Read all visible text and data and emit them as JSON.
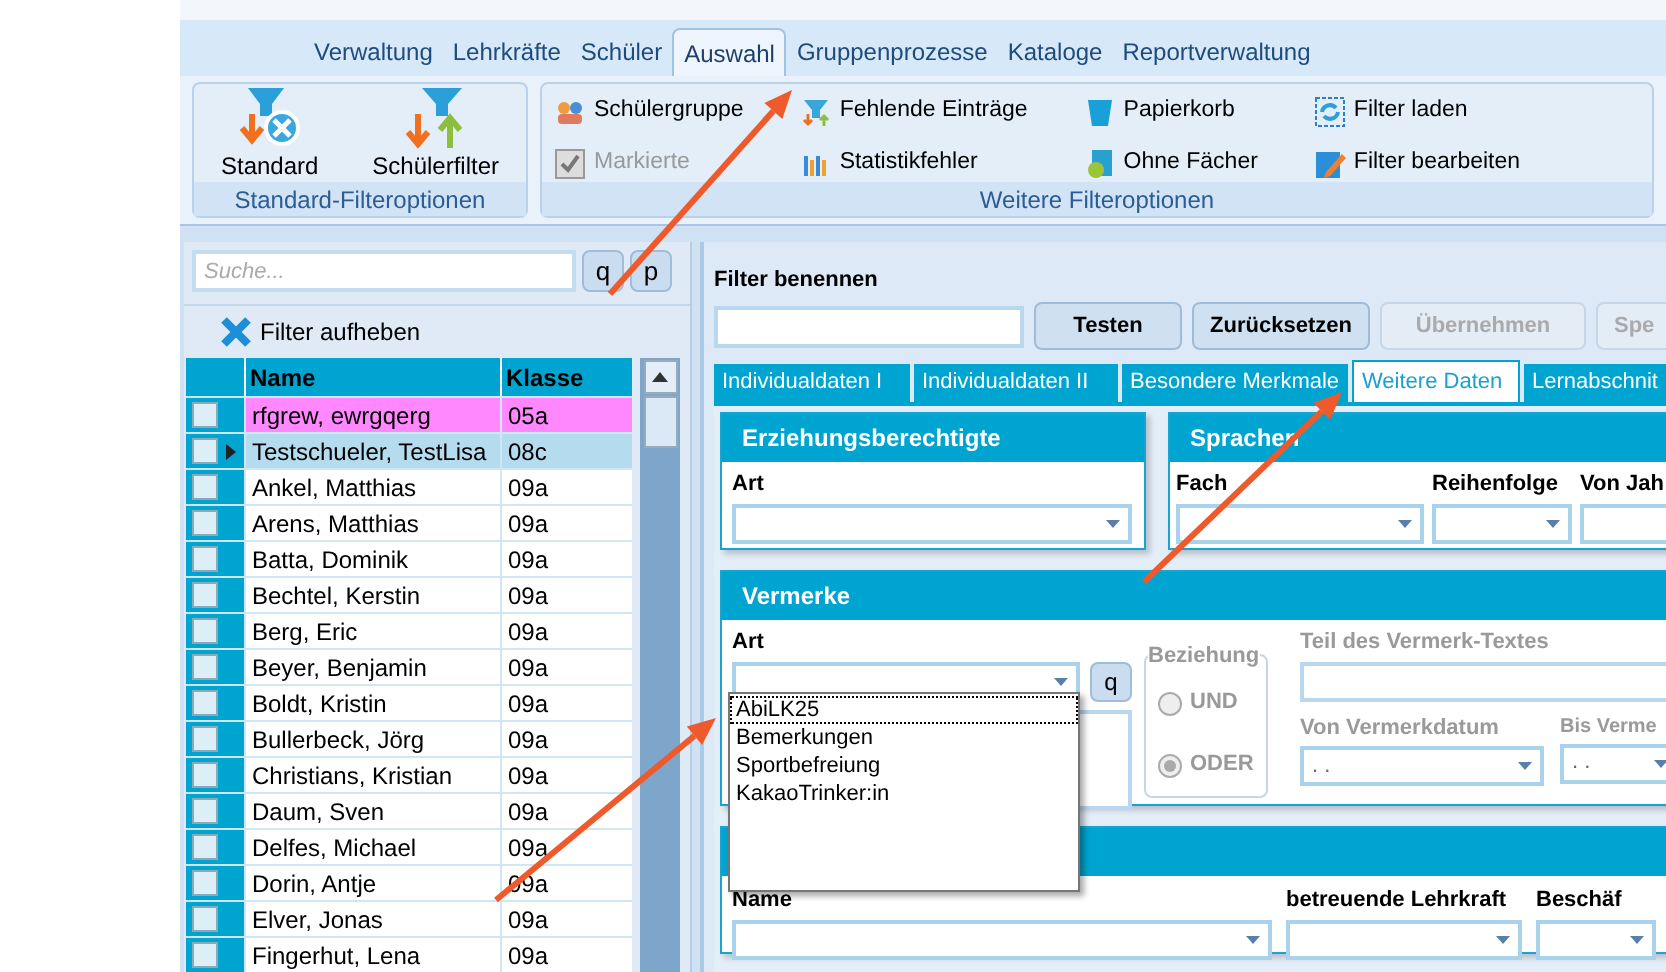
{
  "ribbon": {
    "tabs": [
      {
        "label": "Verwaltung",
        "selected": false
      },
      {
        "label": "Lehrkräfte",
        "selected": false
      },
      {
        "label": "Schüler",
        "selected": false
      },
      {
        "label": "Auswahl",
        "selected": true
      },
      {
        "label": "Gruppenprozesse",
        "selected": false
      },
      {
        "label": "Kataloge",
        "selected": false
      },
      {
        "label": "Reportverwaltung",
        "selected": false
      }
    ],
    "standard_group": {
      "caption": "Standard-Filteroptionen",
      "buttons": [
        {
          "label": "Standard",
          "kind": "standard"
        },
        {
          "label": "Schülerfilter",
          "kind": "filter"
        }
      ]
    },
    "more_group": {
      "caption": "Weitere Filteroptionen",
      "columns": [
        [
          {
            "label": "Schülergruppe",
            "kind": "group",
            "disabled": false
          },
          {
            "label": "Markierte",
            "kind": "check",
            "disabled": true
          }
        ],
        [
          {
            "label": "Fehlende Einträge",
            "kind": "missing",
            "disabled": false
          },
          {
            "label": "Statistikfehler",
            "kind": "stats",
            "disabled": false
          }
        ],
        [
          {
            "label": "Papierkorb",
            "kind": "bin",
            "disabled": false
          },
          {
            "label": "Ohne Fächer",
            "kind": "nosubject",
            "disabled": false
          }
        ],
        [
          {
            "label": "Filter laden",
            "kind": "load",
            "disabled": false
          },
          {
            "label": "Filter bearbeiten",
            "kind": "edit",
            "disabled": false
          }
        ]
      ]
    }
  },
  "student_list": {
    "search": {
      "placeholder": "Suche..."
    },
    "search_buttons": [
      "q",
      "p"
    ],
    "clear_filter": "Filter aufheben",
    "columns": [
      "Name",
      "Klasse"
    ],
    "rows": [
      {
        "name": "rfgrew, ewrgqerg",
        "class": "05a",
        "checked": false,
        "selected": false,
        "color": "#ff88ff"
      },
      {
        "name": "Testschueler, TestLisa",
        "class": "08c",
        "checked": false,
        "selected": true
      },
      {
        "name": "Ankel, Matthias",
        "class": "09a",
        "checked": false,
        "selected": false
      },
      {
        "name": "Arens, Matthias",
        "class": "09a",
        "checked": false,
        "selected": false
      },
      {
        "name": "Batta, Dominik",
        "class": "09a",
        "checked": false,
        "selected": false
      },
      {
        "name": "Bechtel, Kerstin",
        "class": "09a",
        "checked": false,
        "selected": false
      },
      {
        "name": "Berg, Eric",
        "class": "09a",
        "checked": false,
        "selected": false
      },
      {
        "name": "Beyer, Benjamin",
        "class": "09a",
        "checked": false,
        "selected": false
      },
      {
        "name": "Boldt, Kristin",
        "class": "09a",
        "checked": false,
        "selected": false
      },
      {
        "name": "Bullerbeck, Jörg",
        "class": "09a",
        "checked": false,
        "selected": false
      },
      {
        "name": "Christians, Kristian",
        "class": "09a",
        "checked": false,
        "selected": false
      },
      {
        "name": "Daum, Sven",
        "class": "09a",
        "checked": false,
        "selected": false
      },
      {
        "name": "Delfes, Michael",
        "class": "09a",
        "checked": false,
        "selected": false
      },
      {
        "name": "Dorin, Antje",
        "class": "09a",
        "checked": false,
        "selected": false
      },
      {
        "name": "Elver, Jonas",
        "class": "09a",
        "checked": false,
        "selected": false
      },
      {
        "name": "Fingerhut, Lena",
        "class": "09a",
        "checked": false,
        "selected": false
      }
    ]
  },
  "filter": {
    "name_label": "Filter benennen",
    "buttons": [
      {
        "label": "Testen",
        "disabled": false
      },
      {
        "label": "Zurücksetzen",
        "disabled": false
      },
      {
        "label": "Übernehmen",
        "disabled": true
      },
      {
        "label": "Spe",
        "disabled": true
      }
    ],
    "tabs": [
      {
        "label": "Individualdaten I",
        "selected": false
      },
      {
        "label": "Individualdaten II",
        "selected": false
      },
      {
        "label": "Besondere Merkmale",
        "selected": false
      },
      {
        "label": "Weitere Daten",
        "selected": true
      },
      {
        "label": "Lernabschnit",
        "selected": false
      }
    ],
    "guardians": {
      "title": "Erziehungsberechtigte",
      "art_label": "Art"
    },
    "languages": {
      "title": "Sprachen",
      "labels": [
        "Fach",
        "Reihenfolge",
        "Von Jah"
      ]
    },
    "notes": {
      "title": "Vermerke",
      "art_label": "Art",
      "search_button": "q",
      "relation": {
        "label": "Beziehung",
        "options": [
          {
            "label": "UND",
            "selected": false
          },
          {
            "label": "ODER",
            "selected": true
          }
        ]
      },
      "text_label": "Teil des Vermerk-Textes",
      "from_label": "Von Vermerkdatum",
      "from_value": ". .",
      "to_label": "Bis Verme",
      "to_value": ". .",
      "dropdown_options": [
        {
          "label": "AbiLK25",
          "selected": true
        },
        {
          "label": "Bemerkungen",
          "selected": false
        },
        {
          "label": "Sportbefreiung",
          "selected": false
        },
        {
          "label": "KakaoTrinker:in",
          "selected": false
        }
      ]
    },
    "companies": {
      "labels": [
        "Name",
        "betreuende Lehrkraft",
        "Beschäf"
      ]
    }
  }
}
